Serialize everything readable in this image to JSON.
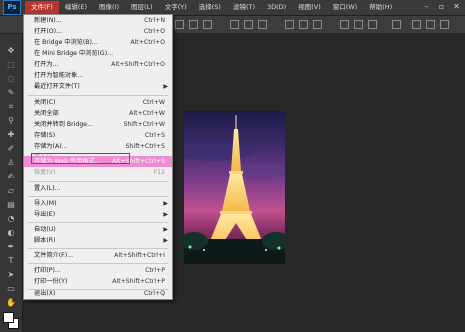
{
  "app": {
    "logo_text": "Ps"
  },
  "menubar": {
    "items": [
      "文件(F)",
      "编辑(E)",
      "图像(I)",
      "图层(L)",
      "文字(Y)",
      "选择(S)",
      "滤镜(T)",
      "3D(D)",
      "视图(V)",
      "窗口(W)",
      "帮助(H)"
    ],
    "active_index": 0
  },
  "file_menu": {
    "items": [
      {
        "label": "新建(N)...",
        "shortcut": "Ctrl+N"
      },
      {
        "label": "打开(O)...",
        "shortcut": "Ctrl+O"
      },
      {
        "label": "在 Bridge 中浏览(B)...",
        "shortcut": "Alt+Ctrl+O"
      },
      {
        "label": "在 Mini Bridge 中浏览(G)...",
        "shortcut": ""
      },
      {
        "label": "打开为...",
        "shortcut": "Alt+Shift+Ctrl+O"
      },
      {
        "label": "打开为智能对象...",
        "shortcut": ""
      },
      {
        "label": "最近打开文件(T)",
        "shortcut": "",
        "submenu": true
      },
      {
        "label": "关闭(C)",
        "shortcut": "Ctrl+W"
      },
      {
        "label": "关闭全部",
        "shortcut": "Alt+Ctrl+W"
      },
      {
        "label": "关闭并转到 Bridge...",
        "shortcut": "Shift+Ctrl+W"
      },
      {
        "label": "存储(S)",
        "shortcut": "Ctrl+S"
      },
      {
        "label": "存储为(A)...",
        "shortcut": "Shift+Ctrl+S"
      },
      {
        "label": "签入(I)...",
        "shortcut": "",
        "disabled": true
      },
      {
        "label": "存储为 Web 所用格式...",
        "shortcut": "Alt+Shift+Ctrl+S",
        "highlight": true
      },
      {
        "label": "恢复(V)",
        "shortcut": "F12",
        "disabled": true
      },
      {
        "label": "置入(L)...",
        "shortcut": ""
      },
      {
        "label": "导入(M)",
        "shortcut": "",
        "submenu": true
      },
      {
        "label": "导出(E)",
        "shortcut": "",
        "submenu": true
      },
      {
        "label": "自动(U)",
        "shortcut": "",
        "submenu": true
      },
      {
        "label": "脚本(R)",
        "shortcut": "",
        "submenu": true
      },
      {
        "label": "文件简介(F)...",
        "shortcut": "Alt+Shift+Ctrl+I"
      },
      {
        "label": "打印(P)...",
        "shortcut": "Ctrl+P"
      },
      {
        "label": "打印一份(Y)",
        "shortcut": "Alt+Shift+Ctrl+P"
      },
      {
        "label": "退出(X)",
        "shortcut": "Ctrl+Q"
      }
    ]
  },
  "colors": {
    "menu_highlight": "#f08ad2",
    "active_menu": "#b8342f",
    "callout_box": "#e02020"
  },
  "icons": {
    "window": [
      "minimize-icon",
      "maximize-icon",
      "close-icon"
    ]
  }
}
